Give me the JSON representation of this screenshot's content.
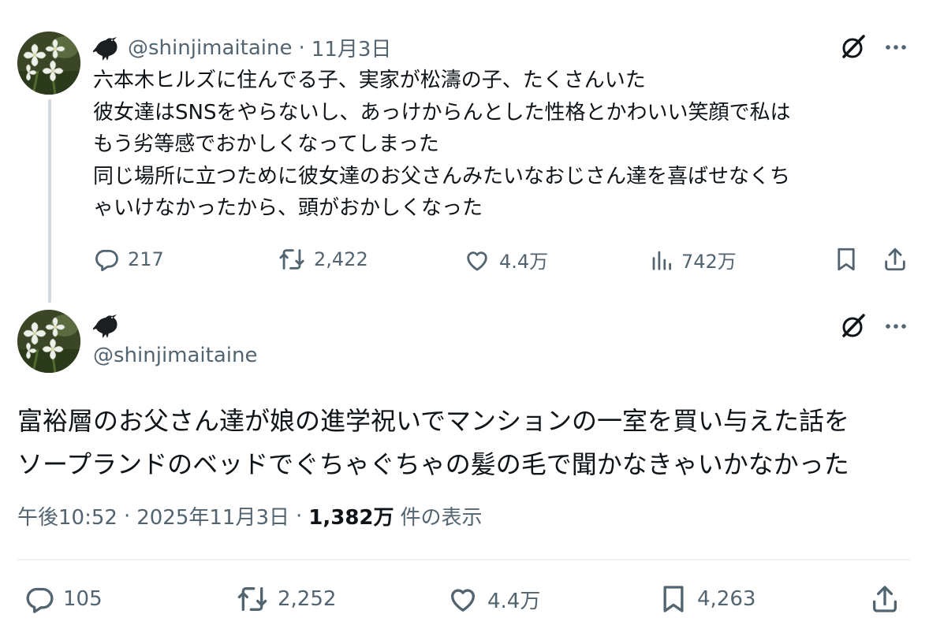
{
  "reply_tweet": {
    "handle": "@shinjimaitaine",
    "separator": "·",
    "date": "11月3日",
    "text_lines": [
      "六本木ヒルズに住んでる子、実家が松濤の子、たくさんいた",
      "彼女達はSNSをやらないし、あっけからんとした性格とかわいい笑顔で私は",
      "もう劣等感でおかしくなってしまった",
      "同じ場所に立つために彼女達のお父さんみたいなおじさん達を喜ばせなくち",
      "ゃいけなかったから、頭がおかしくなった"
    ],
    "replies": "217",
    "reposts": "2,422",
    "likes": "4.4万",
    "views": "742万"
  },
  "main_tweet": {
    "handle": "@shinjimaitaine",
    "text_lines": [
      "富裕層のお父さん達が娘の進学祝いでマンションの一室を買い与えた話を",
      "ソープランドのベッドでぐちゃぐちゃの髪の毛で聞かなきゃいかなかった"
    ],
    "time": "午後10:52",
    "separator": "·",
    "date": "2025年11月3日",
    "views_count": "1,382万",
    "views_label": "件の表示",
    "replies": "105",
    "reposts": "2,252",
    "likes": "4.4万",
    "bookmarks": "4,263"
  },
  "icons": {
    "name_emoji": "crow-icon",
    "grok": "grok-icon",
    "more": "more-icon",
    "reply": "reply-icon",
    "repost": "repost-icon",
    "like": "heart-icon",
    "views": "views-icon",
    "bookmark": "bookmark-icon",
    "share": "share-icon"
  },
  "colors": {
    "text": "#0f1419",
    "secondary": "#536471",
    "thread_line": "#cfd9de",
    "divider": "#eff3f4"
  }
}
